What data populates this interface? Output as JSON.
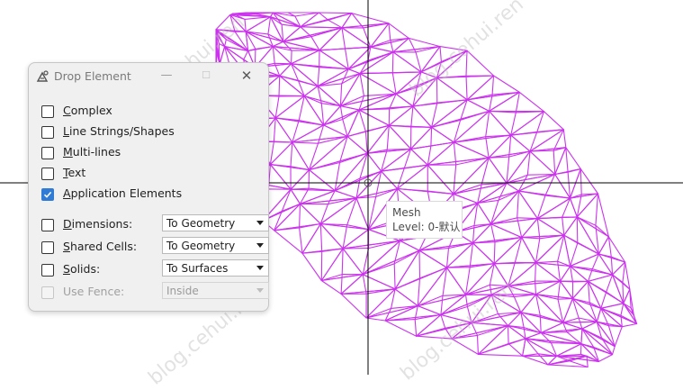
{
  "view": {
    "mesh_color": "#cc33ee",
    "crosshair_color": "#000000"
  },
  "dialog": {
    "title": "Drop Element",
    "icon": "drop-element-icon",
    "items": {
      "complex": {
        "label": "Complex",
        "checked": false
      },
      "linestrings": {
        "label": "Line Strings/Shapes",
        "checked": false
      },
      "multilines": {
        "label": "Multi-lines",
        "checked": false
      },
      "text": {
        "label": "Text",
        "checked": false
      },
      "application": {
        "label": "Application Elements",
        "checked": true
      },
      "dimensions": {
        "label": "Dimensions:",
        "checked": false,
        "option": "To Geometry"
      },
      "shared": {
        "label": "Shared Cells:",
        "checked": false,
        "option": "To Geometry"
      },
      "solids": {
        "label": "Solids:",
        "checked": false,
        "option": "To Surfaces"
      },
      "fence": {
        "label": "Use Fence:",
        "checked": false,
        "enabled": false,
        "option": "Inside"
      }
    }
  },
  "tooltip": {
    "line1": "Mesh",
    "line2": "Level: 0-默认"
  },
  "watermark": "blog.cehui.ren"
}
